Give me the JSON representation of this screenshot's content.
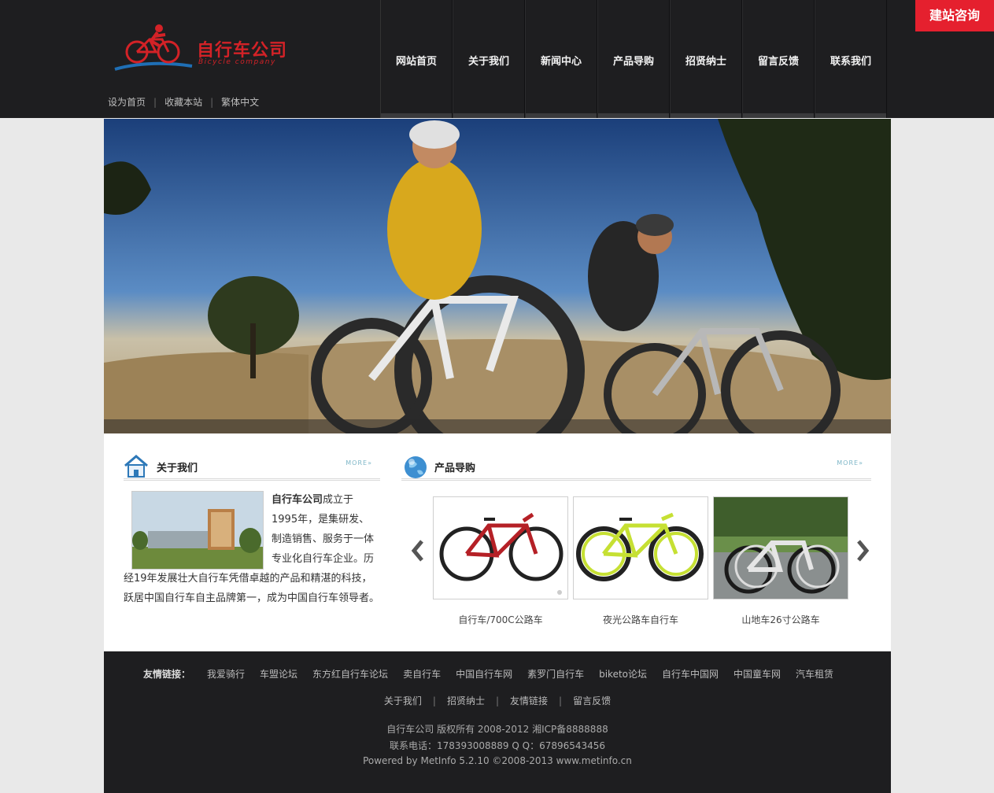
{
  "header": {
    "logo_title": "自行车公司",
    "logo_subtitle": "Bicycle company",
    "top_links": [
      "设为首页",
      "收藏本站",
      "繁体中文"
    ],
    "nav": [
      "网站首页",
      "关于我们",
      "新闻中心",
      "产品导购",
      "招贤纳士",
      "留言反馈",
      "联系我们"
    ],
    "consult_button": "建站咨询"
  },
  "about": {
    "title": "关于我们",
    "more": "MORE»",
    "company": "自行车公司",
    "text": "成立于1995年，是集研发、制造销售、服务于一体专业化自行车企业。历经19年发展壮大自行车凭借卓越的产品和精湛的科技，跃居中国自行车自主品牌第一，成为中国自行车领导者。"
  },
  "products": {
    "title": "产品导购",
    "more": "MORE»",
    "items": [
      {
        "name": "自行车/700C公路车",
        "color": "#b52026"
      },
      {
        "name": "夜光公路车自行车",
        "color": "#c6e033"
      },
      {
        "name": "山地车26寸公路车",
        "color": "#d0d0d0"
      }
    ]
  },
  "footer": {
    "links_label": "友情链接：",
    "links": [
      "我爱骑行",
      "车盟论坛",
      "东方红自行车论坛",
      "卖自行车",
      "中国自行车网",
      "素罗门自行车",
      "biketo论坛",
      "自行车中国网",
      "中国童车网",
      "汽车租赁"
    ],
    "nav": [
      "关于我们",
      "招贤纳士",
      "友情链接",
      "留言反馈"
    ],
    "copyright": "自行车公司 版权所有 2008-2012 湘ICP备8888888",
    "phone": "联系电话：178393008889 Q Q：67896543456",
    "powered": "Powered by MetInfo 5.2.10 ©2008-2013 www.metinfo.cn"
  }
}
